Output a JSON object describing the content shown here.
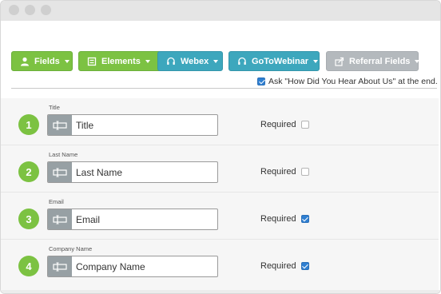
{
  "toolbar": {
    "buttons": [
      {
        "label": "Fields",
        "icon": "user-icon",
        "color": "#7cc242"
      },
      {
        "label": "Elements",
        "icon": "form-icon",
        "color": "#7cc242"
      },
      {
        "label": "Webex",
        "icon": "headset-icon",
        "color": "#3da7bd"
      },
      {
        "label": "GoToWebinar",
        "icon": "headset-icon",
        "color": "#3da7bd"
      },
      {
        "label": "Referral Fields",
        "icon": "share-icon",
        "color": "#b4b9bd"
      }
    ]
  },
  "ask_option": {
    "label": "Ask \"How Did You Hear About Us\" at the end.",
    "checked": true
  },
  "fields": [
    {
      "number": "1",
      "label": "Title",
      "value": "Title",
      "required_label": "Required",
      "required": false
    },
    {
      "number": "2",
      "label": "Last Name",
      "value": "Last Name",
      "required_label": "Required",
      "required": false
    },
    {
      "number": "3",
      "label": "Email",
      "value": "Email",
      "required_label": "Required",
      "required": true
    },
    {
      "number": "4",
      "label": "Company Name",
      "value": "Company Name",
      "required_label": "Required",
      "required": true
    }
  ]
}
